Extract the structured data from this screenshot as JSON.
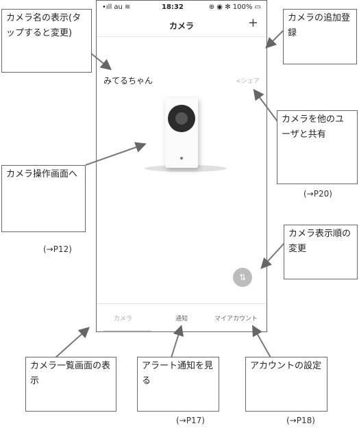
{
  "status_bar": {
    "signal": "•ıll au ≋",
    "time": "18:32",
    "right": "⊕ ◉ ✻ 100% ▭"
  },
  "nav": {
    "title": "カメラ",
    "add_label": "+"
  },
  "camera": {
    "name": "みてるちゃん",
    "share_label": "<シェア"
  },
  "reorder_glyph": "⇅",
  "tabs": [
    {
      "label": "カメラ"
    },
    {
      "label": "通知"
    },
    {
      "label": "マイアカウント"
    }
  ],
  "callouts": {
    "camera_name": "カメラ名の表示(タップすると変更)",
    "add_camera": "カメラの追加登録",
    "share": "カメラを他のユーザと共有",
    "operate": "カメラ操作画面へ",
    "reorder": "カメラ表示順の変更",
    "list_view": "カメラ一覧画面の表示",
    "alerts": "アラート通知を見る",
    "account": "アカウントの設定"
  },
  "refs": {
    "share": "(→P20)",
    "operate": "(→P12)",
    "alerts": "(→P17)",
    "account": "(→P18)"
  }
}
